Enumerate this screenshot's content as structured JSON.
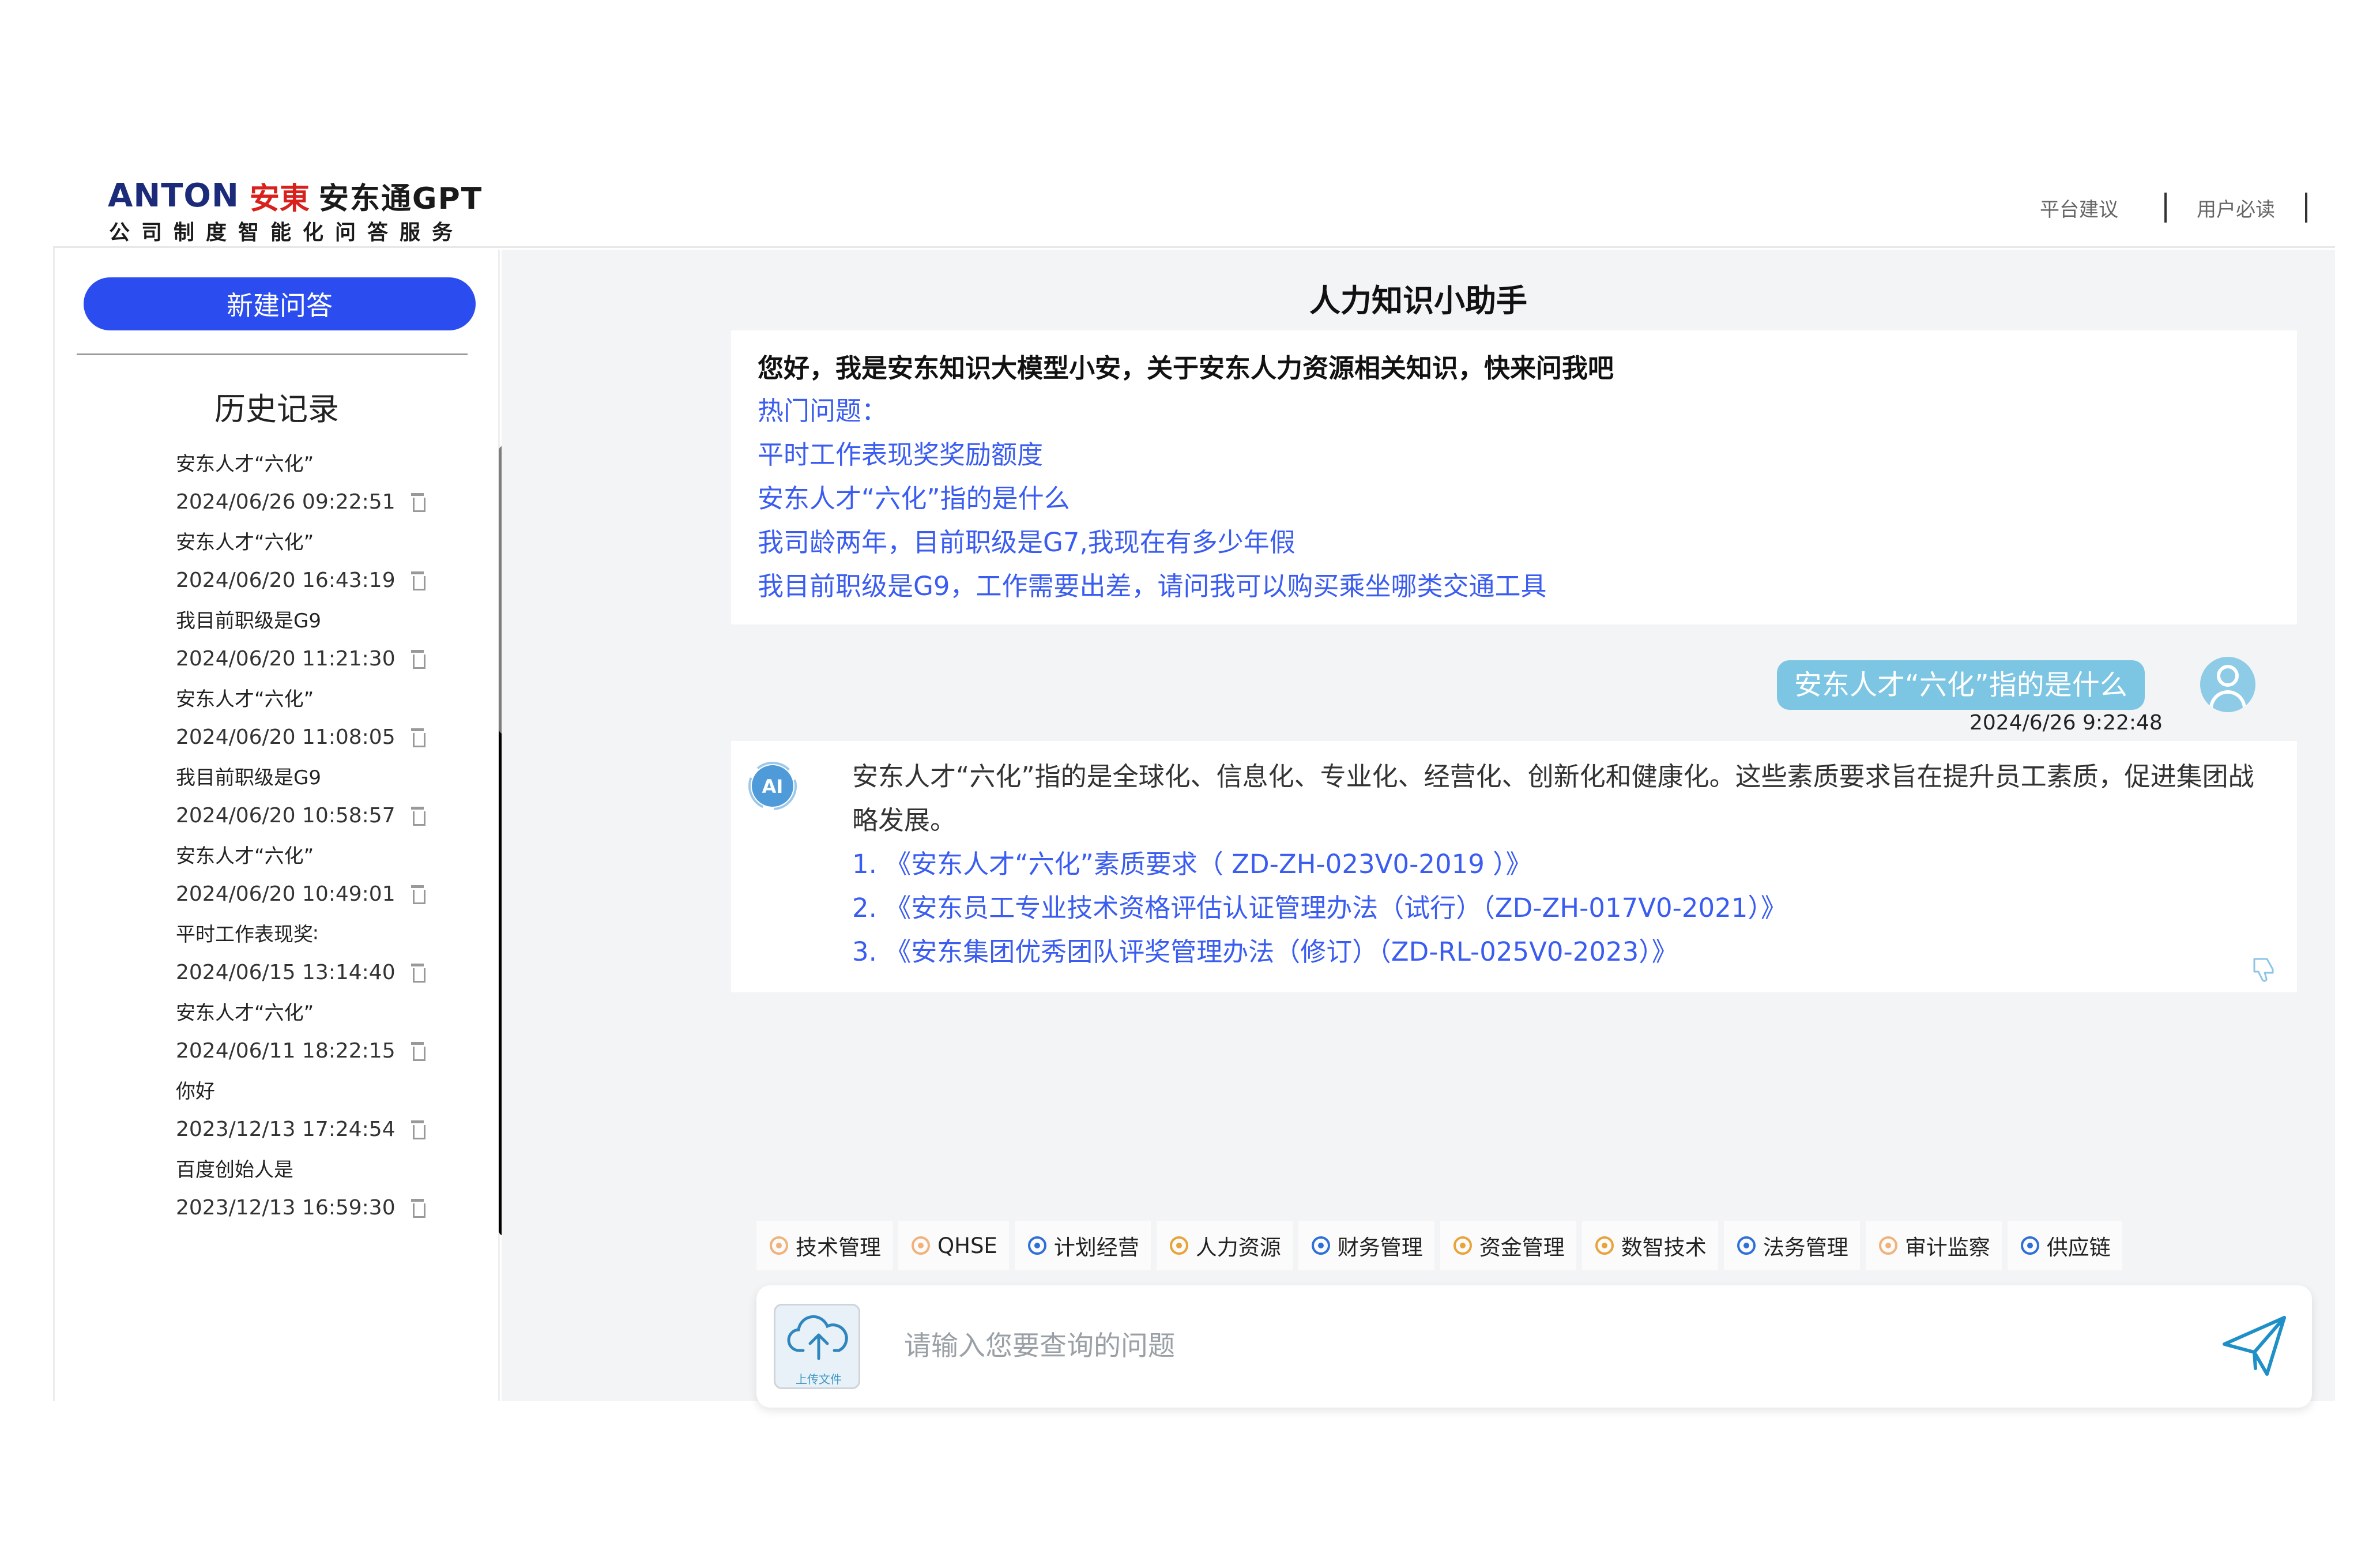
{
  "header": {
    "logo": {
      "brand_en": "ANTON",
      "brand_cn": "安東",
      "product": "安东通GPT",
      "subtitle": "公司制度智能化问答服务"
    },
    "links": [
      "平台建议",
      "用户必读"
    ]
  },
  "sidebar": {
    "new_button": "新建问答",
    "history_title": "历史记录",
    "history": [
      {
        "title": "安东人才“六化”",
        "date": "2024/06/26 09:22:51"
      },
      {
        "title": "安东人才“六化”",
        "date": "2024/06/20 16:43:19"
      },
      {
        "title": "我目前职级是G9",
        "date": "2024/06/20 11:21:30"
      },
      {
        "title": "安东人才“六化”",
        "date": "2024/06/20 11:08:05"
      },
      {
        "title": "我目前职级是G9",
        "date": "2024/06/20 10:58:57"
      },
      {
        "title": "安东人才“六化”",
        "date": "2024/06/20 10:49:01"
      },
      {
        "title": "平时工作表现奖∶",
        "date": "2024/06/15 13:14:40"
      },
      {
        "title": "安东人才“六化”",
        "date": "2024/06/11 18:22:15"
      },
      {
        "title": "你好",
        "date": "2023/12/13 17:24:54"
      },
      {
        "title": "百度创始人是",
        "date": "2023/12/13 16:59:30"
      }
    ]
  },
  "main": {
    "title": "人力知识小助手",
    "welcome": {
      "greeting": "您好，我是安东知识大模型小安，关于安东人力资源相关知识，快来问我吧",
      "hot_label": "热门问题：",
      "questions": [
        "平时工作表现奖奖励额度",
        "安东人才“六化”指的是什么",
        "我司龄两年，目前职级是G7,我现在有多少年假",
        "我目前职级是G9，工作需要出差，请问我可以购买乘坐哪类交通工具"
      ]
    },
    "user_message": {
      "text": "安东人才“六化”指的是什么",
      "time": "2024/6/26 9:22:48"
    },
    "answer": {
      "text": "安东人才“六化”指的是全球化、信息化、专业化、经营化、创新化和健康化。这些素质要求旨在提升员工素质，促进集团战略发展。",
      "references": [
        "1. 《安东人才“六化”素质要求（ ZD-ZH-023V0-2019 ）》",
        "2. 《安东员工专业技术资格评估认证管理办法（试行）（ZD-ZH-017V0-2021）》",
        "3. 《安东集团优秀团队评奖管理办法（修订）（ZD-RL-025V0-2023）》"
      ]
    },
    "categories": [
      {
        "label": "技术管理",
        "icon": "tech-icon",
        "color": "#f0b27a"
      },
      {
        "label": "QHSE",
        "icon": "qhse-icon",
        "color": "#f0b27a"
      },
      {
        "label": "计划经营",
        "icon": "plan-icon",
        "color": "#2f6fd8"
      },
      {
        "label": "人力资源",
        "icon": "hr-icon",
        "color": "#e8a33a"
      },
      {
        "label": "财务管理",
        "icon": "finance-icon",
        "color": "#2f6fd8"
      },
      {
        "label": "资金管理",
        "icon": "fund-icon",
        "color": "#e8a33a"
      },
      {
        "label": "数智技术",
        "icon": "ai-tech-icon",
        "color": "#e8a33a"
      },
      {
        "label": "法务管理",
        "icon": "legal-icon",
        "color": "#2f6fd8"
      },
      {
        "label": "审计监察",
        "icon": "audit-icon",
        "color": "#f0b27a"
      },
      {
        "label": "供应链",
        "icon": "supply-icon",
        "color": "#2f6fd8"
      }
    ],
    "input": {
      "placeholder": "请输入您要查询的问题",
      "upload_label": "上传文件"
    }
  },
  "colors": {
    "primary": "#2b4df0",
    "link": "#3a5cf0",
    "user_bubble": "#7cc5e3",
    "main_bg": "#f3f4f6"
  }
}
